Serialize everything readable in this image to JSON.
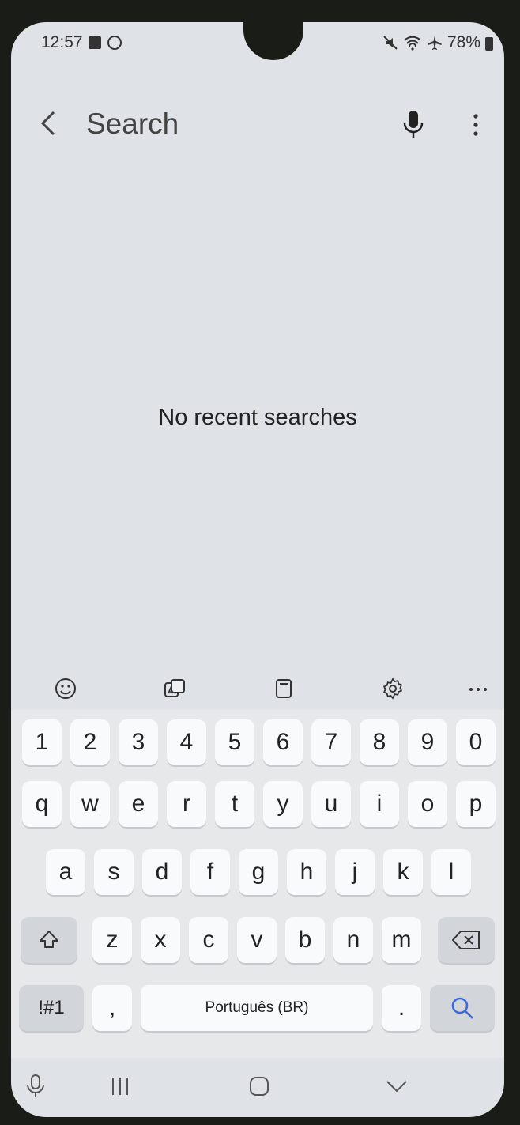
{
  "status_bar": {
    "time": "12:57",
    "battery": "78%"
  },
  "header": {
    "title": "Search"
  },
  "main": {
    "empty_text": "No recent searches"
  },
  "keyboard": {
    "row_numbers": [
      "1",
      "2",
      "3",
      "4",
      "5",
      "6",
      "7",
      "8",
      "9",
      "0"
    ],
    "row_top": [
      "q",
      "w",
      "e",
      "r",
      "t",
      "y",
      "u",
      "i",
      "o",
      "p"
    ],
    "row_middle": [
      "a",
      "s",
      "d",
      "f",
      "g",
      "h",
      "j",
      "k",
      "l"
    ],
    "row_bottom": [
      "z",
      "x",
      "c",
      "v",
      "b",
      "n",
      "m"
    ],
    "symbols_label": "!#1",
    "comma_label": ",",
    "space_label": "Português (BR)",
    "period_label": "."
  },
  "colors": {
    "accent": "#3a6bd8",
    "background": "#dfe2e6"
  }
}
